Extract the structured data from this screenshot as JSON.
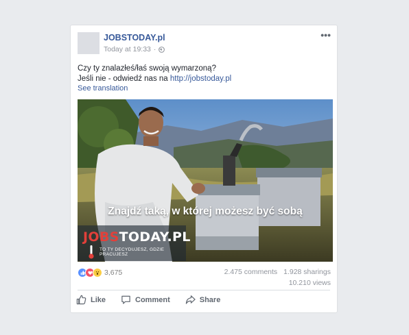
{
  "post": {
    "page_name": "JOBSTODAY.pl",
    "timestamp": "Today at 19:33",
    "separator": "·",
    "more_label": "•••",
    "text_line1": "Czy ty znalazłeś/łaś swoją wymarzoną?",
    "text_line2_prefix": "Jeśli nie - odwiedź nas na ",
    "link": "http://jobstoday.pl",
    "see_translation": "See translation"
  },
  "image": {
    "caption": "Znajdź taką, w której możesz być sobą",
    "logo_part1": "JOBS",
    "logo_part2": "TODAY.PL",
    "logo_tagline": "TO TY DECYDUJESZ, GDZIE PRACUJESZ"
  },
  "stats": {
    "reactions_count": "3,675",
    "comments": "2.475 comments",
    "sharings": "1.928 sharings",
    "views": "10.210 views"
  },
  "actions": {
    "like": "Like",
    "comment": "Comment",
    "share": "Share"
  },
  "icons": {
    "reaction_like": "thumbs-up-icon",
    "reaction_love": "heart-icon",
    "reaction_wow": "wow-face-icon"
  }
}
